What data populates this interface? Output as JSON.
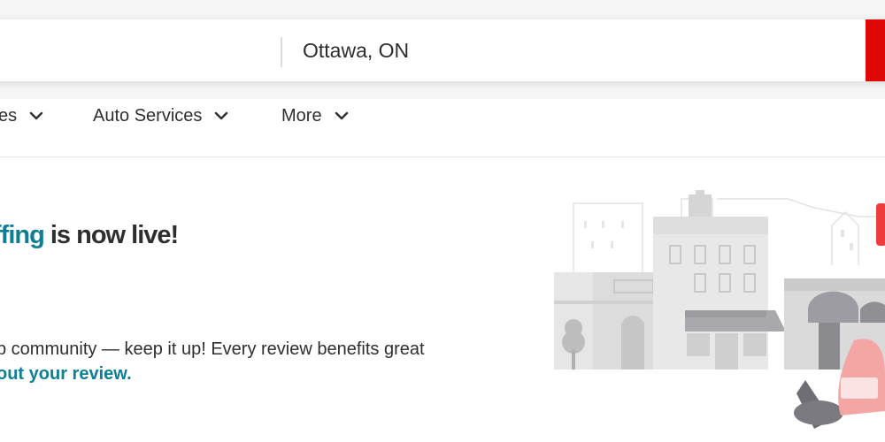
{
  "search": {
    "location_value": "Ottawa, ON"
  },
  "nav": {
    "items": [
      {
        "label": "es"
      },
      {
        "label": "Auto Services"
      },
      {
        "label": "More"
      }
    ]
  },
  "banner": {
    "title_accent": "ffing",
    "title_rest": " is now live!",
    "body_text": "p community — keep it up! Every review benefits great",
    "link_text": "out your review."
  },
  "colors": {
    "brand_red": "#e00707",
    "accent_teal": "#0d7e94"
  }
}
